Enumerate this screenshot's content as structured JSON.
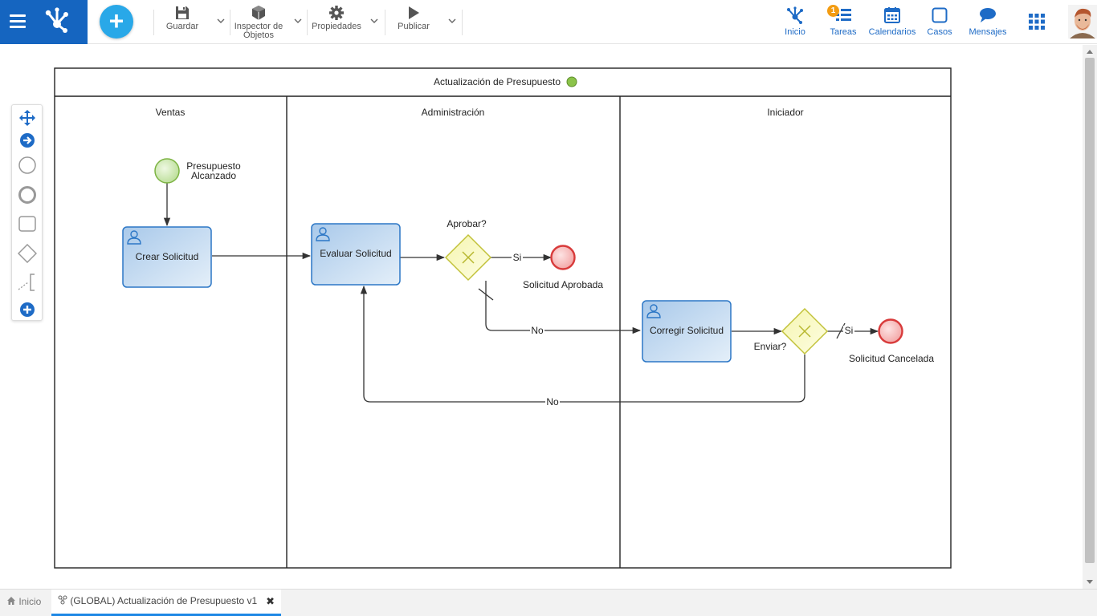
{
  "toolbar": {
    "save": "Guardar",
    "inspector": "Inspector de Objetos",
    "properties": "Propiedades",
    "publish": "Publicar",
    "add": "+"
  },
  "nav": {
    "home": "Inicio",
    "tasks": "Tareas",
    "tasks_badge": "1",
    "calendars": "Calendarios",
    "cases": "Casos",
    "messages": "Mensajes"
  },
  "diagram": {
    "pool_title": "Actualización de  Presupuesto",
    "lanes": [
      "Ventas",
      "Administración",
      "Iniciador"
    ],
    "start_event": [
      "Presupuesto",
      "Alcanzado"
    ],
    "tasks": {
      "create": "Crear Solicitud",
      "evaluate": "Evaluar Solicitud",
      "correct": "Corregir Solicitud"
    },
    "gateways": {
      "approve": "Aprobar?",
      "send": "Enviar?"
    },
    "end_events": {
      "approved": "Solicitud Aprobada",
      "cancelled": "Solicitud Cancelada"
    },
    "flow_labels": {
      "approve_yes": "Si",
      "approve_no": "No",
      "send_yes": "Si",
      "send_no": "No"
    }
  },
  "tabs": {
    "home": "Inicio",
    "active": "(GLOBAL) Actualización de Presupuesto v1",
    "close": "✖"
  },
  "colors": {
    "brand": "#1565c0",
    "accent": "#29a8e8",
    "task_fill": "#c6dcf2",
    "task_stroke": "#2c77c6",
    "gateway_fill": "#fbfbc8",
    "gateway_stroke": "#c2c23a",
    "start_fill": "#cfe9b3",
    "end_fill": "#f4b6b6",
    "end_stroke": "#d83b3b"
  }
}
